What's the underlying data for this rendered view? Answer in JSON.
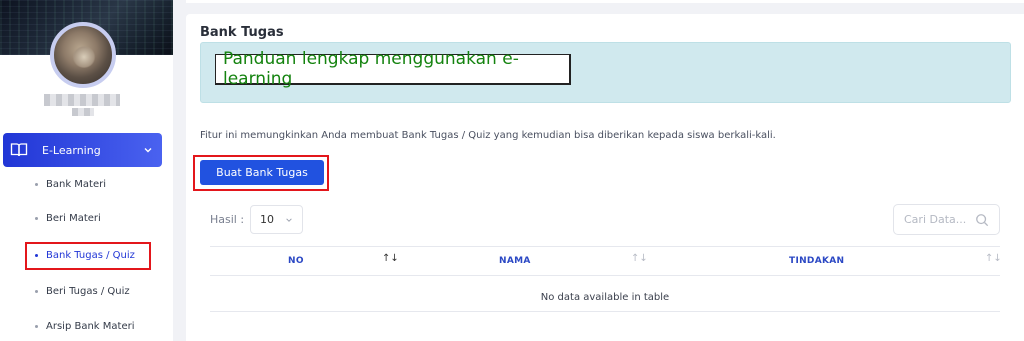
{
  "sidebar": {
    "menu_label": "E-Learning",
    "items": [
      {
        "label": "Bank Materi",
        "active": false
      },
      {
        "label": "Beri Materi",
        "active": false
      },
      {
        "label": "Bank Tugas / Quiz",
        "active": true
      },
      {
        "label": "Beri Tugas / Quiz",
        "active": false
      },
      {
        "label": "Arsip Bank Materi",
        "active": false
      }
    ]
  },
  "main": {
    "title": "Bank Tugas",
    "guide_link": "Panduan lengkap menggunakan e-learning",
    "description": "Fitur ini memungkinkan Anda membuat Bank Tugas / Quiz yang kemudian bisa diberikan kepada siswa berkali-kali.",
    "create_button": "Buat Bank Tugas",
    "page_size_label": "Hasil :",
    "page_size_value": "10",
    "search_placeholder": "Cari Data...",
    "table": {
      "columns": [
        "NO",
        "NAMA",
        "TINDAKAN"
      ],
      "empty_message": "No data available in table"
    }
  },
  "icons": {
    "menu": "book-icon",
    "expand": "chevron-down-icon",
    "select": "chevron-down-icon",
    "search": "search-icon",
    "sort": "sort-icon"
  },
  "colors": {
    "accent": "#2152e0",
    "guide_bg": "#d0e9ee",
    "guide_text": "#14830f",
    "highlight": "#e3161b"
  }
}
